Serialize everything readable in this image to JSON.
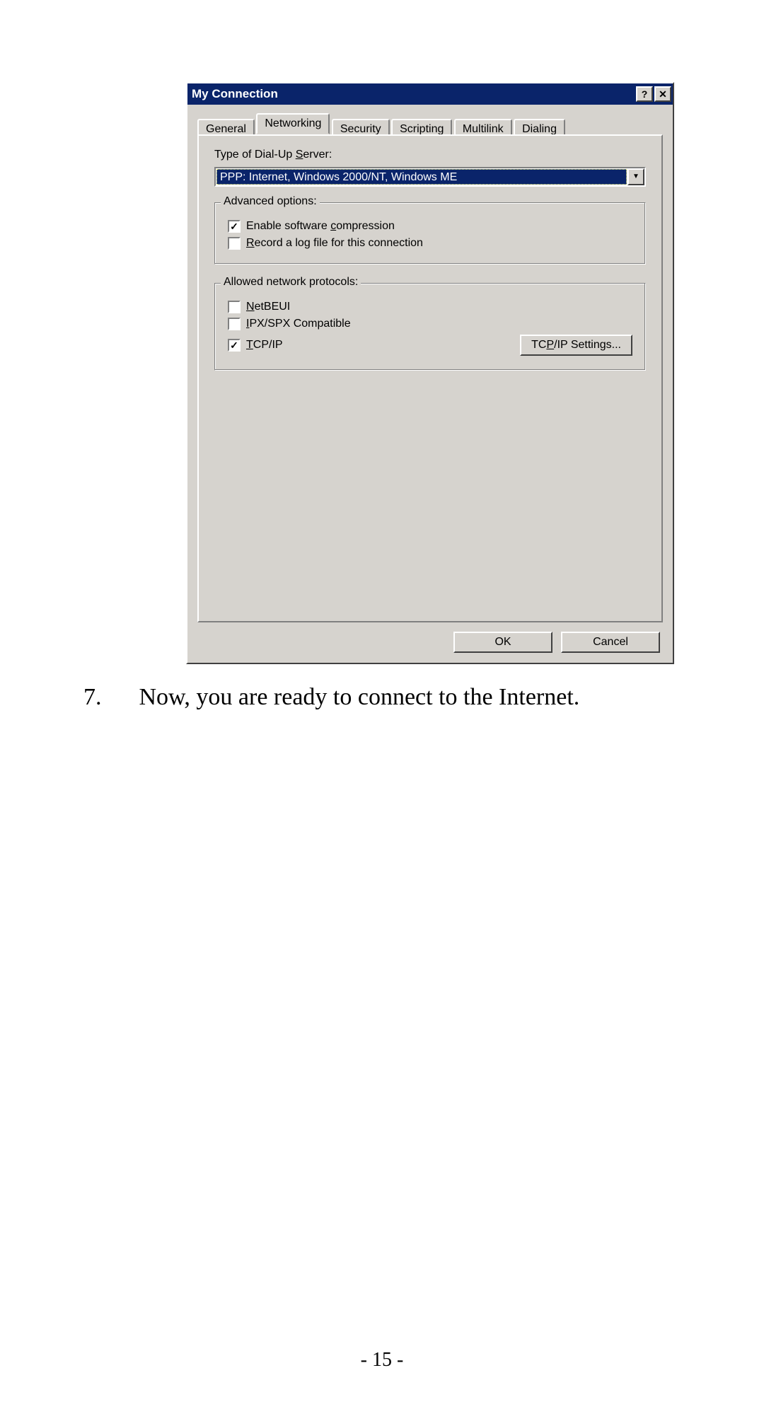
{
  "dialog": {
    "title": "My Connection",
    "help_btn": "?",
    "close_btn": "✕",
    "tabs": {
      "general": "General",
      "networking": "Networking",
      "security": "Security",
      "scripting": "Scripting",
      "multilink": "Multilink",
      "dialing": "Dialing"
    },
    "type_label_pre": "Type of Dial-Up ",
    "type_label_u": "S",
    "type_label_post": "erver:",
    "type_value": "PPP: Internet, Windows 2000/NT, Windows ME",
    "adv_group": "Advanced options:",
    "chk_compress_pre": "Enable software ",
    "chk_compress_u": "c",
    "chk_compress_post": "ompression",
    "chk_log_u": "R",
    "chk_log_post": "ecord a log file for this connection",
    "proto_group": "Allowed network protocols:",
    "p_netbeui_u": "N",
    "p_netbeui_post": "etBEUI",
    "p_ipx_u": "I",
    "p_ipx_post": "PX/SPX Compatible",
    "p_tcp_u": "T",
    "p_tcp_post": "CP/IP",
    "tcp_btn_pre": "TC",
    "tcp_btn_u": "P",
    "tcp_btn_post": "/IP Settings...",
    "ok": "OK",
    "cancel": "Cancel"
  },
  "doc": {
    "step_num": "7.",
    "step_text": "Now, you are ready to connect to the Internet.",
    "page_no": "- 15 -"
  }
}
